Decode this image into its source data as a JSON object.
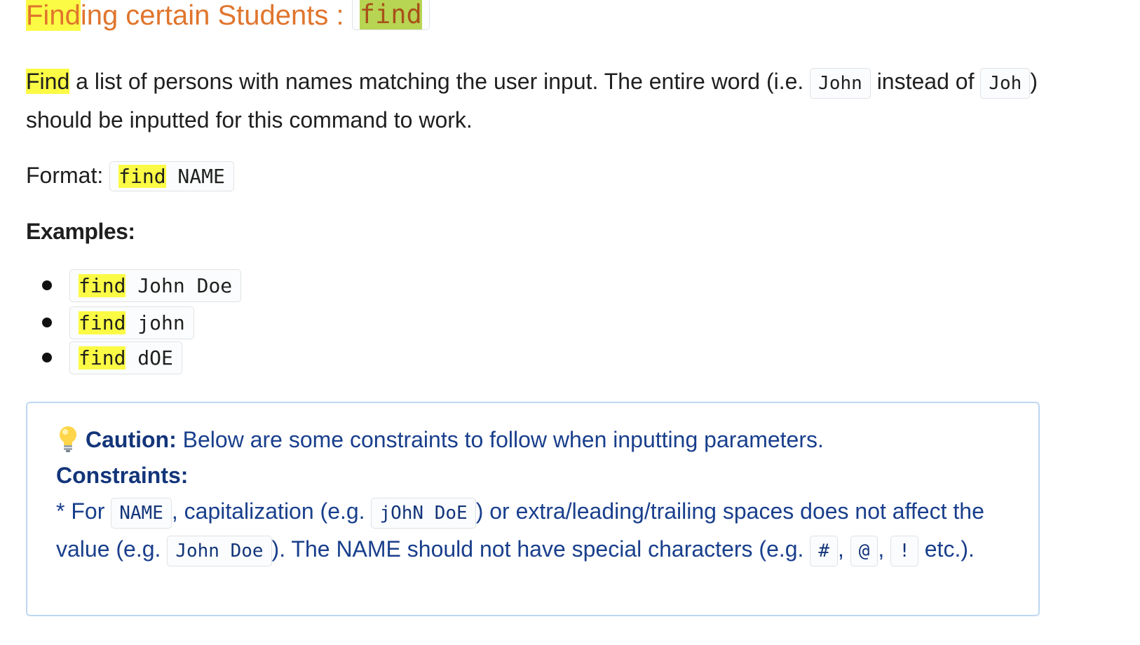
{
  "title": {
    "prefix_highlight": "Find",
    "prefix_rest": "ing certain Students : ",
    "command": "find"
  },
  "description": {
    "highlight": "Find",
    "text_1": " a list of persons with names matching the user input. The entire word (i.e. ",
    "code_1": "John",
    "text_2": " instead of ",
    "code_2": "Joh",
    "text_3": ") should be inputted for this command to work."
  },
  "format": {
    "label": "Format: ",
    "command": "find",
    "argument": " NAME"
  },
  "examples": {
    "heading": "Examples:",
    "items": [
      {
        "command": "find",
        "args": " John Doe"
      },
      {
        "command": "find",
        "args": " john"
      },
      {
        "command": "find",
        "args": " dOE"
      }
    ]
  },
  "callout": {
    "icon": "lightbulb-icon",
    "caution_label": "Caution:",
    "caution_text": " Below are some constraints to follow when inputting parameters.",
    "constraints_label": "Constraints:",
    "line_1a": "* For ",
    "code_name": "NAME",
    "line_1b": ", capitalization (e.g. ",
    "code_caps": "jOhN DoE",
    "line_1c": ") or extra/leading/trailing spaces does not affect the value (e.g. ",
    "code_john": "John Doe",
    "line_1d": "). The NAME should not have special characters (e.g. ",
    "code_hash": "#",
    "sep_1": ", ",
    "code_at": "@",
    "sep_2": ", ",
    "code_bang": "!",
    "line_1e": " etc.)."
  },
  "colors": {
    "title": "#e0752d",
    "highlight": "#fbfb45",
    "callout_text": "#193f8c",
    "callout_border": "#bdd7f1"
  }
}
